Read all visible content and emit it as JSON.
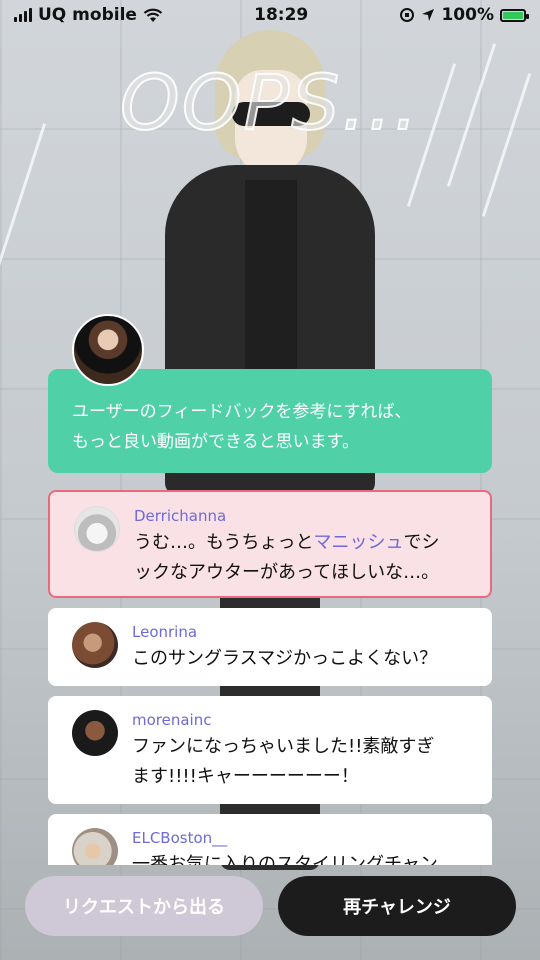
{
  "status_bar": {
    "carrier": "UQ mobile",
    "time": "18:29",
    "battery": "100%",
    "battery_level": 1.0
  },
  "title": "OOPS...",
  "reviewer": {
    "message_line1": "ユーザーのフィードバックを参考にすれば、",
    "message_line2": "もっと良い動画ができると思います。"
  },
  "comments": [
    {
      "user": "Derrichanna",
      "text_line1_pre": "うむ…。もうちょっと",
      "text_line1_accent": "マニッシュ",
      "text_line1_post": "でシ",
      "text_line2": "ックなアウターがあってほしいな…。",
      "highlighted": true
    },
    {
      "user": "Leonrina",
      "text_line1": "このサングラスマジかっこよくない？",
      "highlighted": false
    },
    {
      "user": "morenainc",
      "text_line1": "ファンになっちゃいました!!素敵すぎ",
      "text_line2": "ます!!!!キャーーーーーー！",
      "highlighted": false
    },
    {
      "user": "ELCBoston__",
      "text_line1": "一番お気に入りのスタイリングチャン",
      "highlighted": false
    }
  ],
  "buttons": {
    "leave": "リクエストから出る",
    "retry": "再チャレンジ"
  },
  "colors": {
    "accent_green": "#4fd0a6",
    "accent_purple": "#6e6ad6",
    "highlight_pink": "#e9697d"
  }
}
